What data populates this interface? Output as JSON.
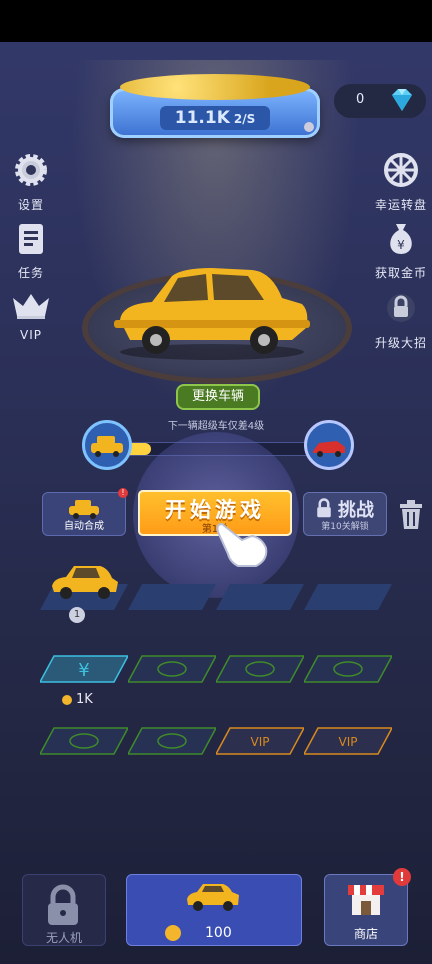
{
  "currency": {
    "income_value": "11.1K",
    "income_unit": "2/S",
    "gems": "0"
  },
  "left_menu": [
    {
      "label": "设置",
      "icon": "gear-icon"
    },
    {
      "label": "任务",
      "icon": "task-list-icon"
    },
    {
      "label": "VIP",
      "icon": "crown-icon"
    }
  ],
  "right_menu": [
    {
      "label": "幸运转盘",
      "icon": "lucky-wheel-icon"
    },
    {
      "label": "获取金币",
      "icon": "money-bag-icon"
    },
    {
      "label": "升级大招",
      "icon": "locked-skill-icon"
    }
  ],
  "vehicle": {
    "swap_label": "更换车辆",
    "next_car_text": "下一辆超级车仅差4级",
    "progress": 0.14
  },
  "actions": {
    "auto_merge_label": "自动合成",
    "auto_merge_badge": "!",
    "start_label": "开始游戏",
    "start_sub": "第1关",
    "challenge_label": "挑战",
    "challenge_sub": "第10关解锁"
  },
  "garage": {
    "car_level": "1",
    "slot_price": "1K"
  },
  "bottom": {
    "locked_label": "无人机",
    "buy_price": "100",
    "shop_label": "商店",
    "shop_badge": "!"
  },
  "colors": {
    "accent": "#ffb020",
    "background": "#2b3058",
    "primary_button": "#3a4db3"
  }
}
